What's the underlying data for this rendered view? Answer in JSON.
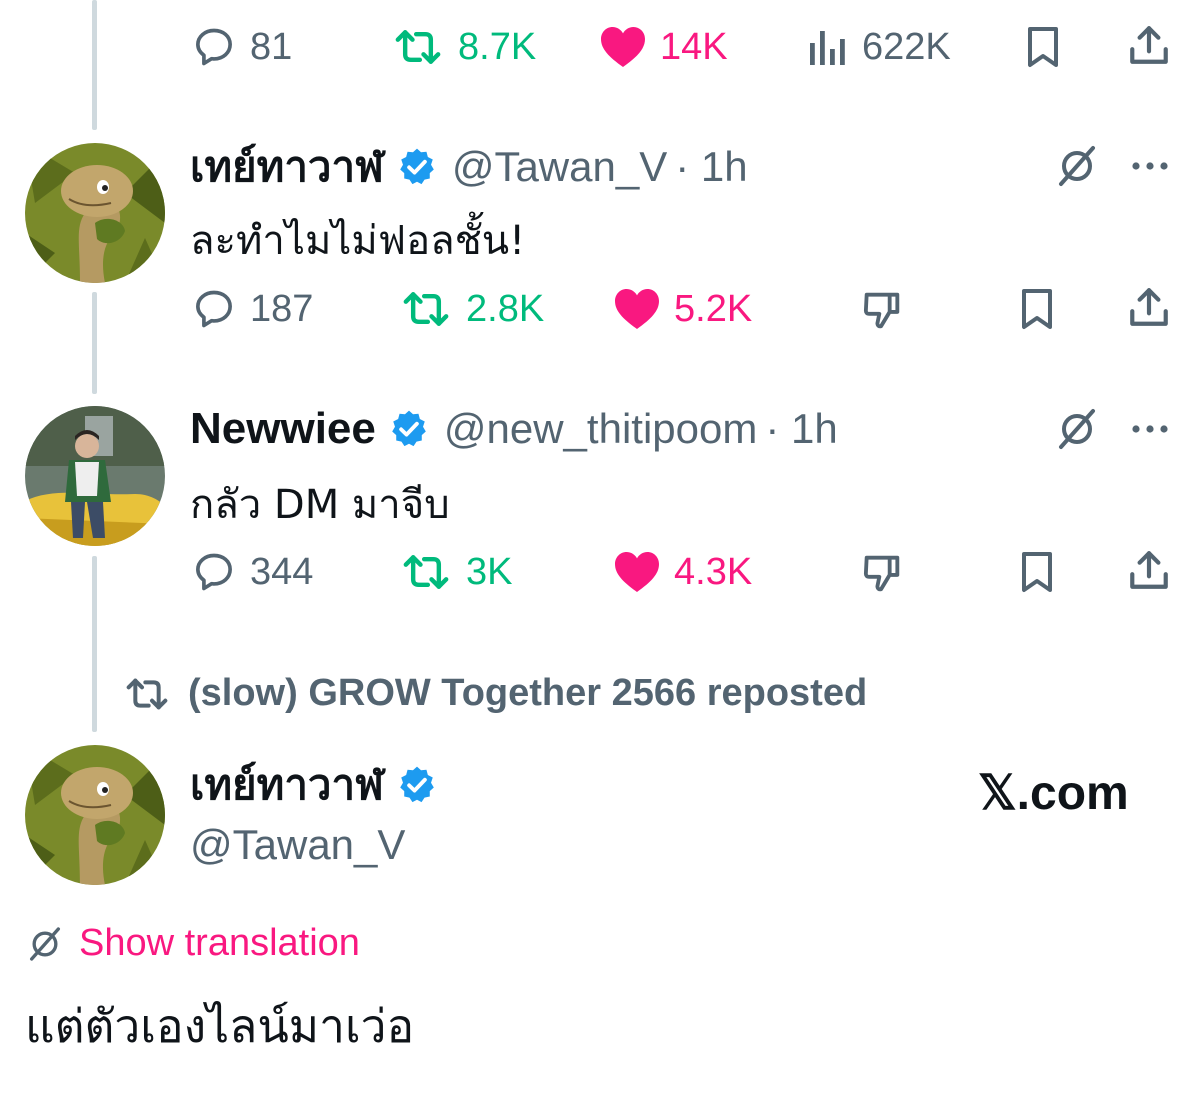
{
  "colors": {
    "text": "#0f1419",
    "secondary": "#536471",
    "repost": "#00ba7c",
    "like": "#f91880",
    "verified": "#1d9bf0",
    "thread_line": "#cfd9de"
  },
  "top_actions": {
    "replies": "81",
    "reposts": "8.7K",
    "likes": "14K",
    "views": "622K"
  },
  "tweets": [
    {
      "name": "เทย์ทาวาฬ",
      "handle": "@Tawan_V",
      "time": "· 1h",
      "text": "ละทำไมไม่ฟอลชั้น!",
      "replies": "187",
      "reposts": "2.8K",
      "likes": "5.2K"
    },
    {
      "name": "Newwiee",
      "handle": "@new_thitipoom",
      "time": "· 1h",
      "text": "กลัว DM มาจีบ",
      "replies": "344",
      "reposts": "3K",
      "likes": "4.3K"
    }
  ],
  "repost_label": "(slow) GROW Together 2566 reposted",
  "main_tweet": {
    "name": "เทย์ทาวาฬ",
    "handle": "@Tawan_V",
    "show_translation": "Show translation",
    "text": "แต่ตัวเองไลน์มาเว่อ"
  },
  "brand": "𝕏.com",
  "icons": [
    "reply-icon",
    "repost-icon",
    "like-icon",
    "views-icon",
    "bookmark-icon",
    "share-icon",
    "grok-icon",
    "more-icon",
    "downvote-icon",
    "verified-badge-icon",
    "translate-icon"
  ]
}
